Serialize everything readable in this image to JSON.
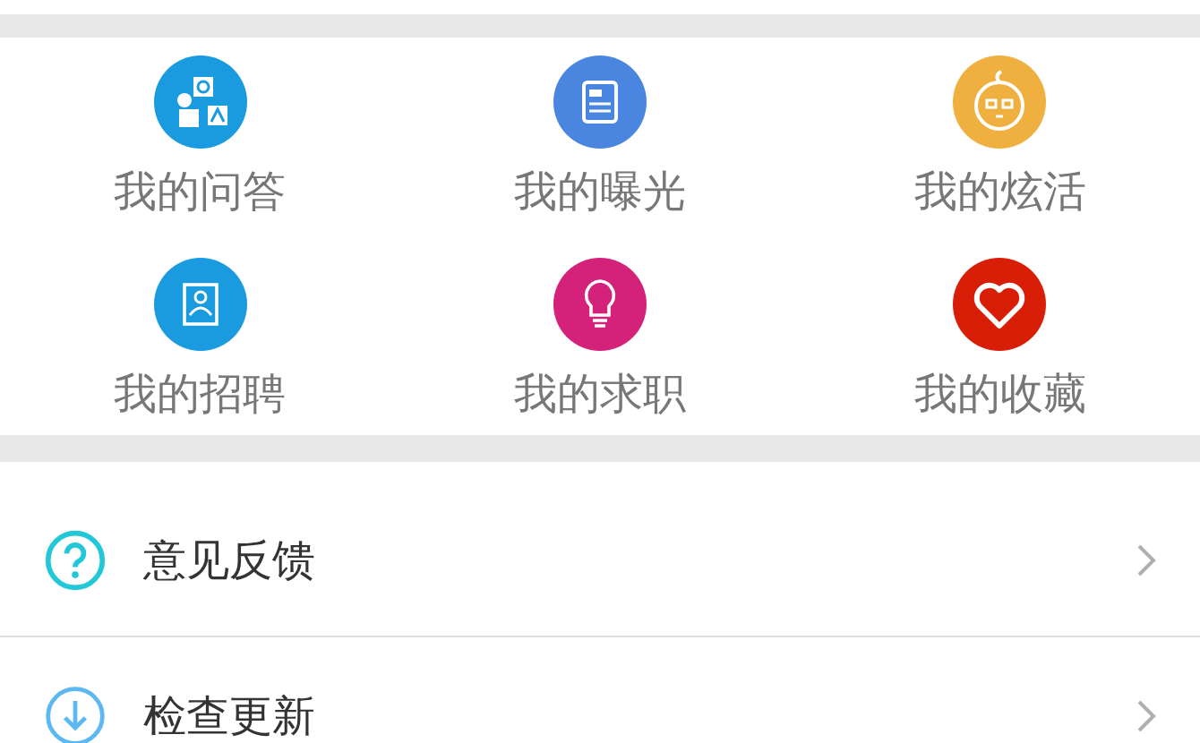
{
  "shortcuts": [
    {
      "label": "我的问答"
    },
    {
      "label": "我的曝光"
    },
    {
      "label": "我的炫活"
    },
    {
      "label": "我的招聘"
    },
    {
      "label": "我的求职"
    },
    {
      "label": "我的收藏"
    }
  ],
  "menu": [
    {
      "label": "意见反馈"
    },
    {
      "label": "检查更新"
    }
  ]
}
